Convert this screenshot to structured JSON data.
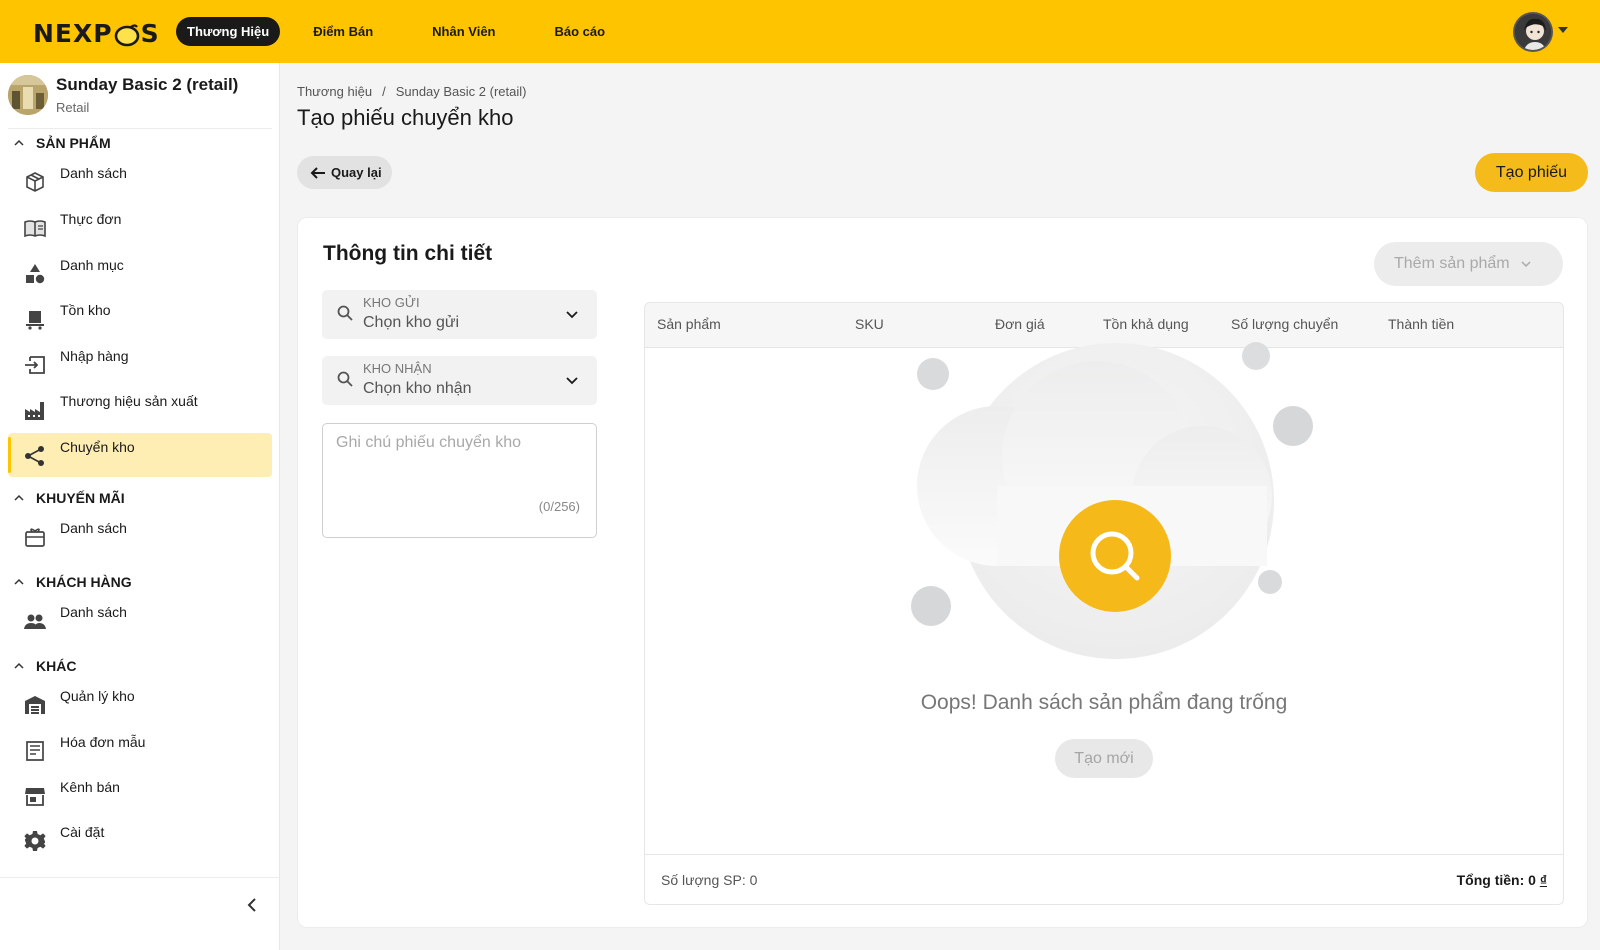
{
  "brand": {
    "logo_left": "NEXP",
    "logo_right": "S",
    "accent_color": "#ffc400"
  },
  "topnav": {
    "items": [
      {
        "label": "Thương Hiệu",
        "active": true
      },
      {
        "label": "Điểm Bán",
        "active": false
      },
      {
        "label": "Nhân Viên",
        "active": false
      },
      {
        "label": "Báo cáo",
        "active": false
      }
    ]
  },
  "store": {
    "name": "Sunday Basic 2 (retail)",
    "type": "Retail"
  },
  "sidebar": {
    "sections": [
      {
        "title": "SẢN PHẨM",
        "items": [
          {
            "label": "Danh sách",
            "icon": "box-icon"
          },
          {
            "label": "Thực đơn",
            "icon": "menu-book-icon"
          },
          {
            "label": "Danh mục",
            "icon": "category-icon"
          },
          {
            "label": "Tồn kho",
            "icon": "warehouse-cart-icon"
          },
          {
            "label": "Nhập hàng",
            "icon": "import-icon"
          },
          {
            "label": "Thương hiệu sản xuất",
            "icon": "factory-icon"
          },
          {
            "label": "Chuyển kho",
            "icon": "share-icon",
            "active": true
          }
        ]
      },
      {
        "title": "KHUYẾN MÃI",
        "items": [
          {
            "label": "Danh sách",
            "icon": "voucher-icon"
          }
        ]
      },
      {
        "title": "KHÁCH HÀNG",
        "items": [
          {
            "label": "Danh sách",
            "icon": "people-icon"
          }
        ]
      },
      {
        "title": "KHÁC",
        "items": [
          {
            "label": "Quản lý kho",
            "icon": "warehouse-icon"
          },
          {
            "label": "Hóa đơn mẫu",
            "icon": "receipt-icon"
          },
          {
            "label": "Kênh bán",
            "icon": "store-icon"
          },
          {
            "label": "Cài đặt",
            "icon": "gear-icon"
          }
        ]
      }
    ]
  },
  "breadcrumb": {
    "root": "Thương hiệu",
    "sep": "/",
    "current": "Sunday Basic 2 (retail)"
  },
  "page": {
    "title": "Tạo phiếu chuyển kho"
  },
  "actions": {
    "back_label": "Quay lại",
    "create_label": "Tạo phiếu"
  },
  "detail": {
    "title": "Thông tin chi tiết",
    "add_product_label": "Thêm sản phẩm",
    "from_warehouse": {
      "label": "KHO GỬI",
      "value": "Chọn kho gửi"
    },
    "to_warehouse": {
      "label": "KHO NHẬN",
      "value": "Chọn kho nhận"
    },
    "note": {
      "placeholder": "Ghi chú phiếu chuyển kho",
      "counter": "(0/256)"
    }
  },
  "table": {
    "columns": [
      "Sản phẩm",
      "SKU",
      "Đơn giá",
      "Tồn khả dụng",
      "Số lượng chuyển",
      "Thành tiền"
    ],
    "empty_text": "Oops! Danh sách sản phẩm đang trống",
    "new_label": "Tạo mới",
    "count_label": "Số lượng SP: 0",
    "total_label": "Tổng tiền: 0",
    "currency": "₫"
  }
}
